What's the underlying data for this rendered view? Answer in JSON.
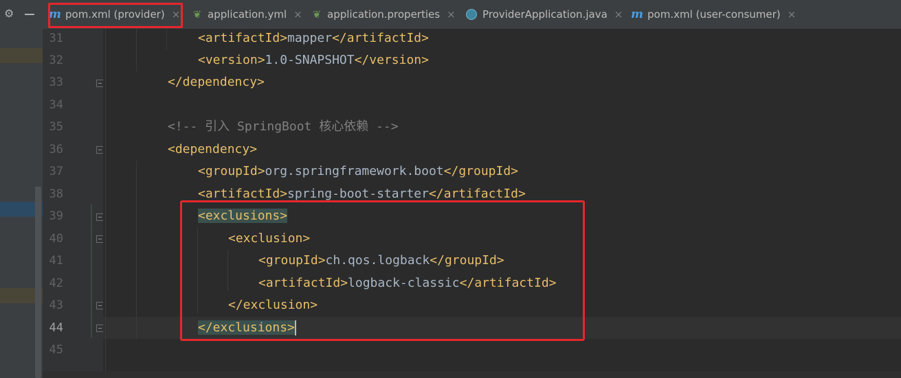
{
  "left_toolbar": {
    "settings_icon": "gear-icon",
    "minimize_icon": "minimize-icon",
    "bands": [
      "#4a4637",
      "#2d4a65",
      "#4a4637"
    ]
  },
  "tabs": [
    {
      "icon": "maven-icon",
      "icon_text": "m",
      "label": "pom.xml (provider)",
      "active": true,
      "close": "×"
    },
    {
      "icon": "spring-leaf-icon",
      "icon_text": "❦",
      "label": "application.yml",
      "close": "×"
    },
    {
      "icon": "spring-leaf-icon",
      "icon_text": "❦",
      "label": "application.properties",
      "close": "×"
    },
    {
      "icon": "java-class-icon",
      "icon_text": "",
      "label": "ProviderApplication.java",
      "close": "×"
    },
    {
      "icon": "maven-icon",
      "icon_text": "m",
      "label": "pom.xml (user-consumer)",
      "close": "×"
    }
  ],
  "editor": {
    "current_line": "44",
    "line_numbers": [
      "31",
      "32",
      "33",
      "34",
      "35",
      "36",
      "37",
      "38",
      "39",
      "40",
      "41",
      "42",
      "43",
      "44",
      "45"
    ],
    "lines": [
      {
        "open": "<artifactId>",
        "text": "mapper",
        "close": "</artifactId>"
      },
      {
        "open": "<version>",
        "text": "1.0-SNAPSHOT",
        "close": "</version>"
      },
      {
        "open": "</dependency>",
        "text": "",
        "close": ""
      },
      {
        "open": "",
        "text": "",
        "close": ""
      },
      {
        "comment": "<!-- 引入 SpringBoot 核心依赖 -->"
      },
      {
        "open": "<dependency>",
        "text": "",
        "close": ""
      },
      {
        "open": "<groupId>",
        "text": "org.springframework.boot",
        "close": "</groupId>"
      },
      {
        "open": "<artifactId>",
        "text": "spring-boot-starter",
        "close": "</artifactId>"
      },
      {
        "open": "<exclusions>",
        "text": "",
        "close": ""
      },
      {
        "open": "<exclusion>",
        "text": "",
        "close": ""
      },
      {
        "open": "<groupId>",
        "text": "ch.qos.logback",
        "close": "</groupId>"
      },
      {
        "open": "<artifactId>",
        "text": "logback-classic",
        "close": "</artifactId>"
      },
      {
        "open": "</exclusion>",
        "text": "",
        "close": ""
      },
      {
        "open": "</exclusions>",
        "text": "",
        "close": ""
      },
      {
        "open": "",
        "text": "",
        "close": ""
      }
    ]
  },
  "colors": {
    "tag": "#e8bf6a",
    "text": "#a9b7c6",
    "comment": "#808080",
    "highlight_box": "#e8262d",
    "background": "#2b2b2b"
  }
}
